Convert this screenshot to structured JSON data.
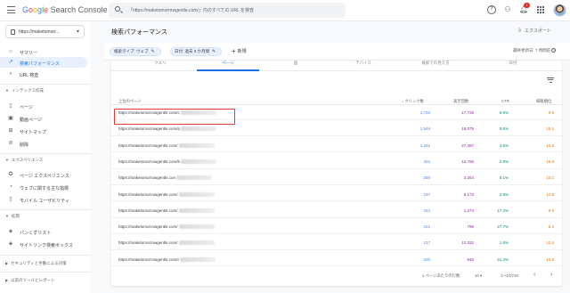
{
  "app": {
    "logo_parts": [
      "G",
      "o",
      "o",
      "g",
      "l",
      "e",
      " Search Console"
    ],
    "search_placeholder": "「https://maketomorrowgentle.com/」内のすべての URL を検査",
    "notification_count": "1"
  },
  "sidebar": {
    "property_label": "https://maketomorr...",
    "items": [
      {
        "label": "サマリー",
        "icon": "home-icon"
      },
      {
        "label": "検索パフォーマンス",
        "icon": "trend-icon"
      },
      {
        "label": "URL 検査",
        "icon": "search-icon"
      }
    ],
    "sections": [
      {
        "title": "インデックス作成",
        "items": [
          {
            "label": "ページ",
            "icon": "page-icon"
          },
          {
            "label": "動画ページ",
            "icon": "video-page-icon"
          },
          {
            "label": "サイトマップ",
            "icon": "sitemap-icon"
          },
          {
            "label": "削除",
            "icon": "removal-icon"
          }
        ]
      },
      {
        "title": "エクスペリエンス",
        "items": [
          {
            "label": "ページ エクスペリエンス",
            "icon": "experience-icon"
          },
          {
            "label": "ウェブに関する主な指標",
            "icon": "speed-icon"
          },
          {
            "label": "モバイル ユーザビリティ",
            "icon": "mobile-icon"
          }
        ]
      },
      {
        "title": "拡張",
        "items": [
          {
            "label": "パンくずリスト",
            "icon": "breadcrumb-icon"
          },
          {
            "label": "サイトリンク検索ボックス",
            "icon": "sitelinks-icon"
          }
        ]
      },
      {
        "title": "セキュリティと手動による対策",
        "items": []
      },
      {
        "title": "以前のツールとレポート",
        "items": []
      }
    ]
  },
  "main": {
    "title": "検索パフォーマンス",
    "export_label": "エクスポート",
    "chips": [
      "検索タイプ: ウェブ",
      "日付: 過去 3 か月間"
    ],
    "add_new_label": "新規",
    "last_updated": "最終更新日: 7 時間前",
    "tabs": [
      "クエリ",
      "ページ",
      "国",
      "デバイス",
      "検索での見え方",
      "日付"
    ],
    "table": {
      "headers": {
        "page": "上位のページ",
        "clicks": "クリック数",
        "impressions": "表示回数",
        "ctr": "CTR",
        "position": "掲載順位"
      },
      "rows": [
        {
          "url": "https://maketomorrowgentle.com/c",
          "clicks": "1,702",
          "impressions": "17,735",
          "ctr": "9.6%",
          "position": "9.5"
        },
        {
          "url": "https://maketomorrowgentle.com/p",
          "clicks": "1,549",
          "impressions": "18,075",
          "ctr": "8.6%",
          "position": "10.1"
        },
        {
          "url": "https://maketomorrowgentle.com/",
          "clicks": "1,241",
          "impressions": "27,497",
          "ctr": "4.5%",
          "position": "12.5"
        },
        {
          "url": "https://maketomorrowgentle.com/b",
          "clicks": "404",
          "impressions": "15,795",
          "ctr": "2.6%",
          "position": "18.8"
        },
        {
          "url": "https://maketomorrowgentle.con",
          "clicks": "266",
          "impressions": "3,264",
          "ctr": "8.1%",
          "position": "10.2"
        },
        {
          "url": "https://maketomorrowgentle.com/",
          "clicks": "237",
          "impressions": "8,173",
          "ctr": "2.9%",
          "position": "13.8"
        },
        {
          "url": "https://maketomorrowgentle.com/",
          "clicks": "222",
          "impressions": "1,274",
          "ctr": "17.4%",
          "position": "9.9"
        },
        {
          "url": "https://maketomorrowgentle.com/",
          "clicks": "221",
          "impressions": "798",
          "ctr": "27.7%",
          "position": "5.4"
        },
        {
          "url": "https://maketomorrowgentle.com/",
          "clicks": "217",
          "impressions": "12,332",
          "ctr": "1.8%",
          "position": "12.5"
        },
        {
          "url": "https://maketomorrowgentle.com/r",
          "clicks": "200",
          "impressions": "945",
          "ctr": "21.2%",
          "position": "10.8"
        }
      ]
    },
    "pagination": {
      "rows_per_page_label": "1 ページあたりの行数:",
      "rows_per_page": "10",
      "range": "1～10/720"
    }
  },
  "colors": {
    "clicks": "#4285f4",
    "impressions": "#8e24aa",
    "ctr": "#00897b",
    "position": "#e8710a",
    "accent": "#1a73e8",
    "highlight_box": "#e53935"
  }
}
